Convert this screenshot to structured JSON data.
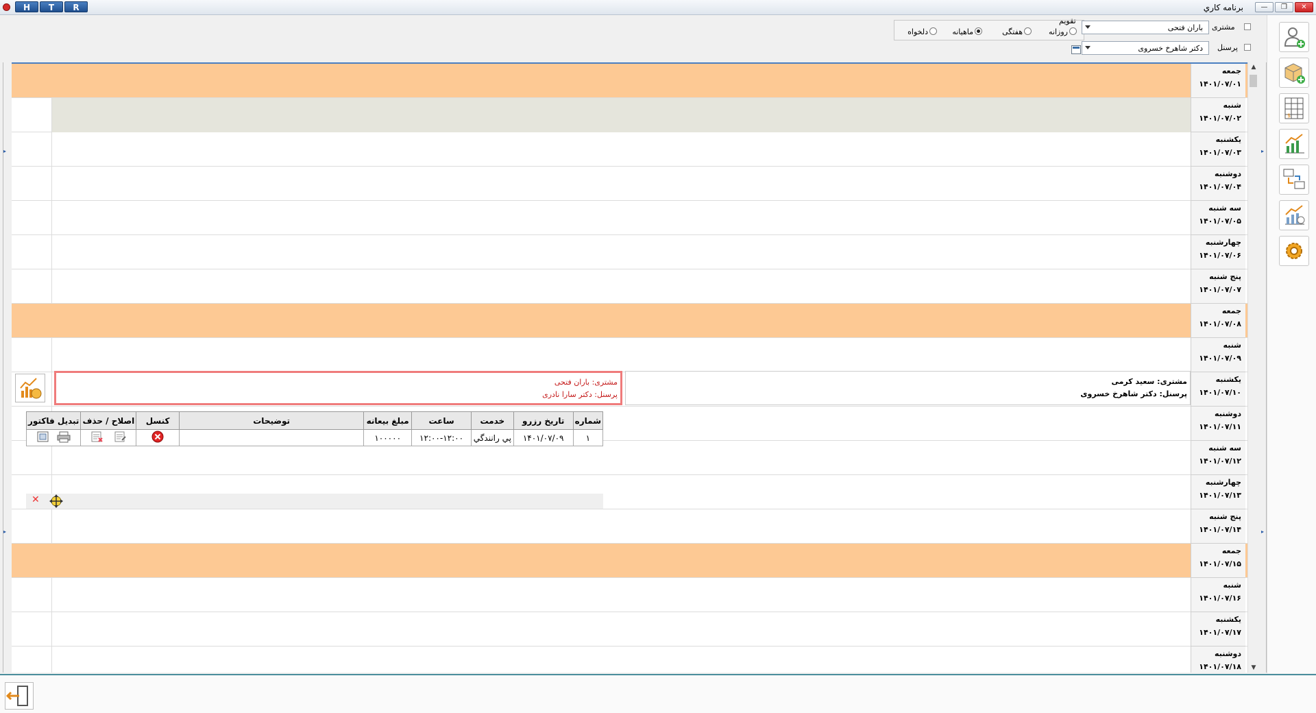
{
  "titlebar": {
    "title": "برنامه کاري",
    "htr": [
      "H",
      "T",
      "R"
    ],
    "window_controls": {
      "minimize": "—",
      "restore": "❐",
      "close": "✕"
    }
  },
  "filters": {
    "customer_label": "مشتری",
    "customer_value": "باران فتحی",
    "staff_label": "پرسنل",
    "staff_value": "دکتر شاهرخ خسروی",
    "calendar_label": "تقویم",
    "modes": [
      {
        "label": "روزانه",
        "selected": false
      },
      {
        "label": "هفتگی",
        "selected": false
      },
      {
        "label": "ماهیانه",
        "selected": true
      },
      {
        "label": "دلخواه",
        "selected": false
      }
    ]
  },
  "days": [
    {
      "name": "جمعه",
      "date": "۱۴۰۱/۰۷/۰۱",
      "holiday": true
    },
    {
      "name": "شنبه",
      "date": "۱۴۰۱/۰۷/۰۲",
      "holiday": false,
      "selected": true
    },
    {
      "name": "یکشنبه",
      "date": "۱۴۰۱/۰۷/۰۳",
      "holiday": false
    },
    {
      "name": "دوشنبه",
      "date": "۱۴۰۱/۰۷/۰۴",
      "holiday": false
    },
    {
      "name": "سه شنبه",
      "date": "۱۴۰۱/۰۷/۰۵",
      "holiday": false
    },
    {
      "name": "چهارشنبه",
      "date": "۱۴۰۱/۰۷/۰۶",
      "holiday": false
    },
    {
      "name": "پنج شنبه",
      "date": "۱۴۰۱/۰۷/۰۷",
      "holiday": false
    },
    {
      "name": "جمعه",
      "date": "۱۴۰۱/۰۷/۰۸",
      "holiday": true
    },
    {
      "name": "شنبه",
      "date": "۱۴۰۱/۰۷/۰۹",
      "holiday": false
    },
    {
      "name": "یکشنبه",
      "date": "۱۴۰۱/۰۷/۱۰",
      "holiday": false
    },
    {
      "name": "دوشنبه",
      "date": "۱۴۰۱/۰۷/۱۱",
      "holiday": false
    },
    {
      "name": "سه شنبه",
      "date": "۱۴۰۱/۰۷/۱۲",
      "holiday": false
    },
    {
      "name": "چهارشنبه",
      "date": "۱۴۰۱/۰۷/۱۳",
      "holiday": false
    },
    {
      "name": "پنج شنبه",
      "date": "۱۴۰۱/۰۷/۱۴",
      "holiday": false
    },
    {
      "name": "جمعه",
      "date": "۱۴۰۱/۰۷/۱۵",
      "holiday": true
    },
    {
      "name": "شنبه",
      "date": "۱۴۰۱/۰۷/۱۶",
      "holiday": false
    },
    {
      "name": "یکشنبه",
      "date": "۱۴۰۱/۰۷/۱۷",
      "holiday": false
    },
    {
      "name": "دوشنبه",
      "date": "۱۴۰۱/۰۷/۱۸",
      "holiday": false
    }
  ],
  "popup": {
    "selected_customer": "مشتری: باران فتحی",
    "selected_staff": "پرسنل: دکتر سارا نادری",
    "other_customer": "مشتری: سعید کرمی",
    "other_staff": "پرسنل: دکتر شاهرخ خسروی",
    "columns": [
      "شماره",
      "تاریخ رزرو",
      "خدمت",
      "ساعت",
      "مبلغ بیعانه",
      "توضیحات",
      "کنسل",
      "اصلاح / حذف",
      "تبدیل فاکتور"
    ],
    "row": {
      "number": "۱",
      "date": "۱۴۰۱/۰۷/۰۹",
      "service": "پي رانندگي",
      "time": "۱۲:۰۰-۱۲:۰۰",
      "deposit": "۱۰۰۰۰۰",
      "notes": ""
    },
    "close_glyph": "✕"
  },
  "sidebar": [
    "add-customer-icon",
    "add-product-icon",
    "price-table-icon",
    "chart-icon",
    "transfer-icon",
    "report-chart-icon",
    "settings-gear-icon"
  ],
  "colors": {
    "holiday": "#fdc994",
    "selected_row": "#e5e5dc",
    "accent": "#4a7fc1"
  }
}
